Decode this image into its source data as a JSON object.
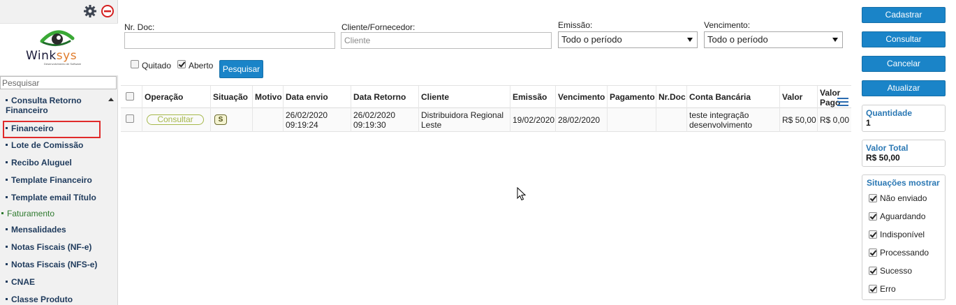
{
  "sidebar": {
    "search_placeholder": "Pesquisar",
    "logo": {
      "name": "Winksys",
      "prefix": "Wink",
      "suffix": "sys",
      "tagline": "Desenvolvimento de Software"
    },
    "items": [
      {
        "label": "Consulta Retorno",
        "label2": "Financeiro",
        "type": "item"
      },
      {
        "label": "Financeiro",
        "type": "item",
        "highlighted": true
      },
      {
        "label": "Lote de Comissão",
        "type": "item"
      },
      {
        "label": "Recibo Aluguel",
        "type": "item"
      },
      {
        "label": "Template Financeiro",
        "type": "item"
      },
      {
        "label": "Template email Título",
        "type": "item"
      },
      {
        "label": "Faturamento",
        "type": "group"
      },
      {
        "label": "Mensalidades",
        "type": "item"
      },
      {
        "label": "Notas Fiscais (NF-e)",
        "type": "item"
      },
      {
        "label": "Notas Fiscais (NFS-e)",
        "type": "item"
      },
      {
        "label": "CNAE",
        "type": "item"
      },
      {
        "label": "Classe Produto",
        "type": "item"
      }
    ]
  },
  "filters": {
    "nr_doc_label": "Nr. Doc:",
    "nr_doc_value": "",
    "cliente_label": "Cliente/Fornecedor:",
    "cliente_placeholder": "Cliente",
    "emissao_label": "Emissão:",
    "emissao_value": "Todo o período",
    "vencimento_label": "Vencimento:",
    "vencimento_value": "Todo o período",
    "quitado_label": "Quitado",
    "quitado_checked": false,
    "aberto_label": "Aberto",
    "aberto_checked": true,
    "pesquisar_label": "Pesquisar"
  },
  "table": {
    "headers": {
      "operacao": "Operação",
      "situacao": "Situação",
      "motivo": "Motivo",
      "data_envio": "Data envio",
      "data_retorno": "Data Retorno",
      "cliente": "Cliente",
      "emissao": "Emissão",
      "vencimento": "Vencimento",
      "pagamento": "Pagamento",
      "nr_doc": "Nr.Doc",
      "conta_bancaria": "Conta Bancária",
      "valor": "Valor",
      "valor_pago_1": "Valor",
      "valor_pago_2": "Pago"
    },
    "rows": [
      {
        "operacao": "Consultar",
        "situacao": "S",
        "motivo": "",
        "data_envio_1": "26/02/2020",
        "data_envio_2": "09:19:24",
        "data_retorno_1": "26/02/2020",
        "data_retorno_2": "09:19:30",
        "cliente_1": "Distribuidora Regional",
        "cliente_2": "Leste",
        "emissao": "19/02/2020",
        "vencimento": "28/02/2020",
        "pagamento": "",
        "nr_doc": "",
        "conta_1": "teste integração",
        "conta_2": "desenvolvimento",
        "valor": "R$ 50,00",
        "valor_pago": "R$ 0,00"
      }
    ]
  },
  "actions": {
    "cadastrar": "Cadastrar",
    "consultar": "Consultar",
    "cancelar": "Cancelar",
    "atualizar": "Atualizar"
  },
  "summary": {
    "quantidade_label": "Quantidade",
    "quantidade_value": "1",
    "valor_total_label": "Valor Total",
    "valor_total_value": "R$ 50,00"
  },
  "situacoes": {
    "title": "Situações mostrar",
    "items": [
      {
        "label": "Não enviado",
        "checked": true
      },
      {
        "label": "Aguardando",
        "checked": true
      },
      {
        "label": "Indisponível",
        "checked": true
      },
      {
        "label": "Processando",
        "checked": true
      },
      {
        "label": "Sucesso",
        "checked": true
      },
      {
        "label": "Erro",
        "checked": true
      }
    ]
  },
  "colors": {
    "primary_button": "#1a84c8",
    "menu_text": "#1e3a5c",
    "group_text": "#2f7a2f",
    "highlight_border": "#e02b2b",
    "pill_border": "#a5b84a",
    "info_title": "#2b78b4"
  },
  "icons": {
    "settings": "gear-icon",
    "close": "minus-circle-icon",
    "column_menu": "menu-lines-icon"
  }
}
